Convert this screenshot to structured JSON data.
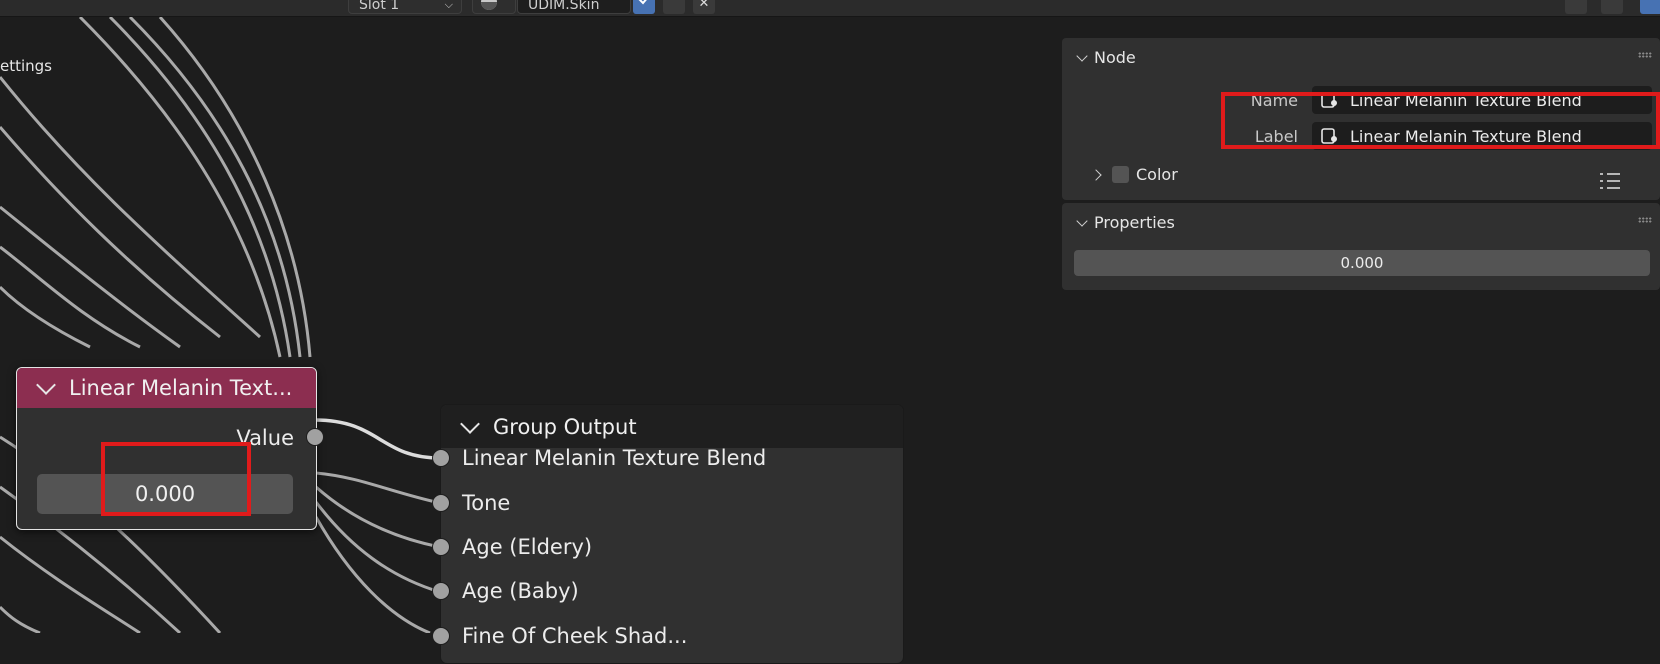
{
  "header": {
    "slot": "Slot 1",
    "material_name": "UDIM.Skin"
  },
  "canvas": {
    "settings_fragment": "ettings"
  },
  "value_node": {
    "title": "Linear Melanin Text...",
    "output_label": "Value",
    "value": "0.000",
    "header_color": "#8c2e50"
  },
  "group_output": {
    "title": "Group Output",
    "inputs": [
      "Linear Melanin Texture Blend",
      "Tone",
      "Age (Eldery)",
      "Age (Baby)",
      "Fine Of Cheek Shad..."
    ]
  },
  "sidebar": {
    "node_panel": {
      "title": "Node",
      "name_label": "Name",
      "name_value": "Linear Melanin Texture Blend",
      "label_label": "Label",
      "label_value": "Linear Melanin Texture Blend",
      "color_label": "Color"
    },
    "properties_panel": {
      "title": "Properties",
      "value": "0.000"
    }
  },
  "highlight_color": "#e01b1b"
}
